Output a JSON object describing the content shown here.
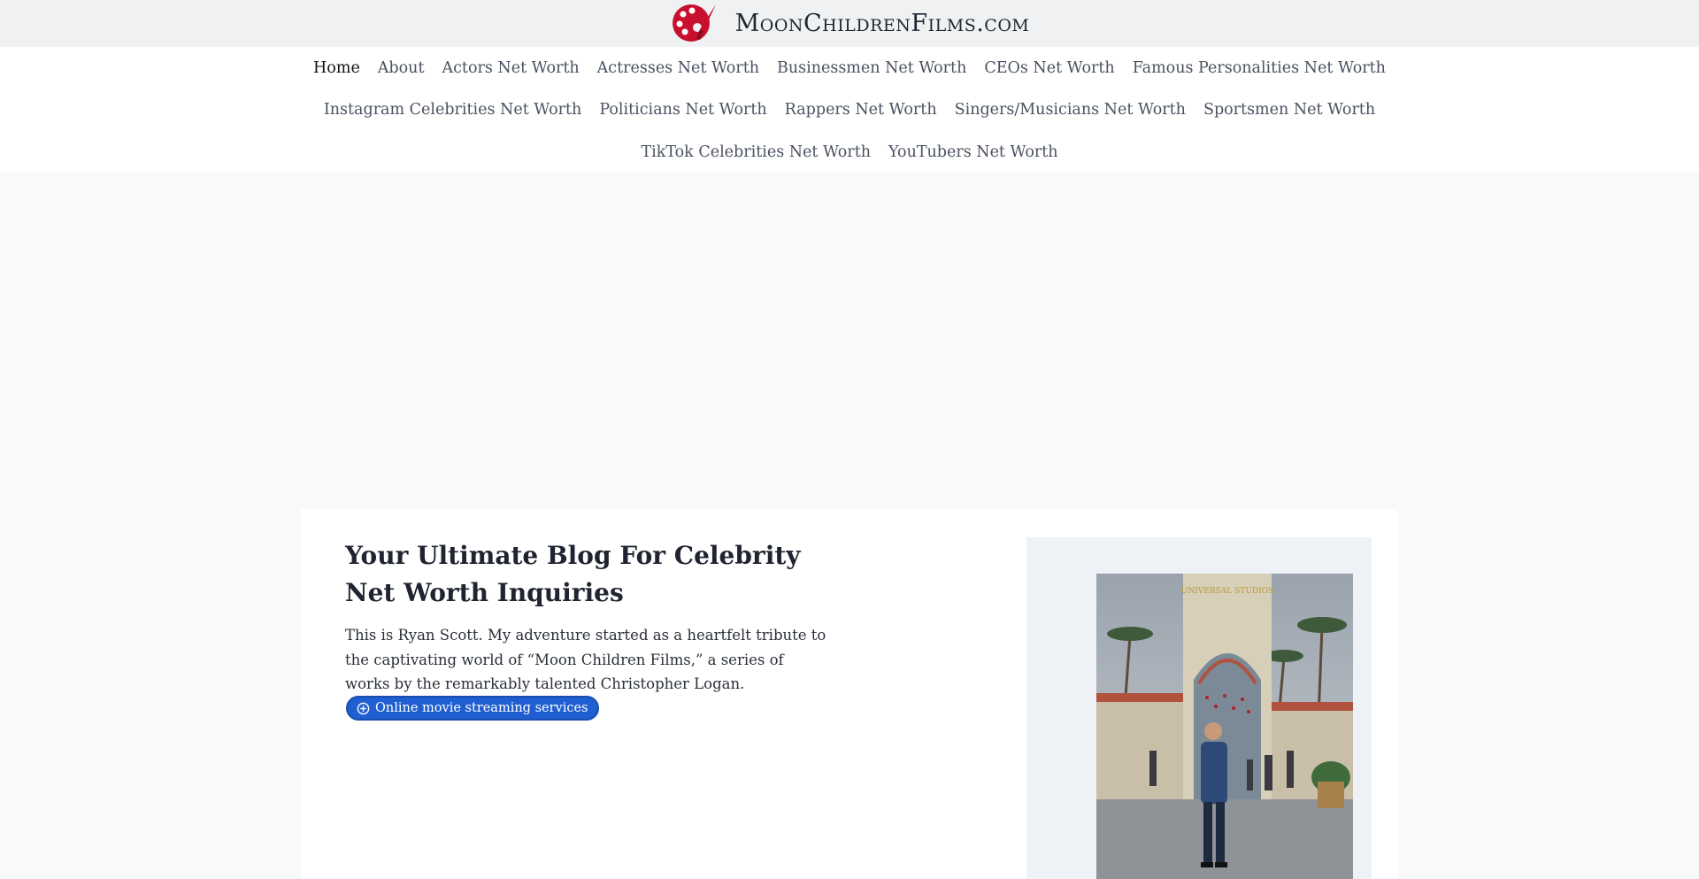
{
  "site": {
    "name": "MoonChildrenFilms.com",
    "logo_icon": "palette-icon",
    "colors": {
      "brand_red": "#c8102e",
      "link_blue": "#1f5fd1"
    }
  },
  "nav": {
    "row1": [
      {
        "label": "Home"
      },
      {
        "label": "About"
      },
      {
        "label": "Actors Net Worth"
      },
      {
        "label": "Actresses Net Worth"
      },
      {
        "label": "Businessmen Net Worth"
      },
      {
        "label": "CEOs Net Worth"
      },
      {
        "label": "Famous Personalities Net Worth"
      }
    ],
    "row2": [
      {
        "label": "Instagram Celebrities Net Worth"
      },
      {
        "label": "Politicians Net Worth"
      },
      {
        "label": "Rappers Net Worth"
      },
      {
        "label": "Singers/Musicians Net Worth"
      },
      {
        "label": "Sportsmen Net Worth"
      }
    ],
    "row3": [
      {
        "label": "TikTok Celebrities Net Worth"
      },
      {
        "label": "YouTubers Net Worth"
      }
    ]
  },
  "hero": {
    "title": "Your Ultimate Blog For Celebrity Net Worth Inquiries",
    "text": "This is Ryan Scott. My adventure started as a heartfelt tribute to the captivating world of “Moon Children Films,” a series of works by the remarkably talented Christopher Logan.",
    "button_label": "Online movie streaming services",
    "button_icon": "plus-circle-icon"
  },
  "photo": {
    "gate_sign": "UNIVERSAL STUDIOS"
  }
}
